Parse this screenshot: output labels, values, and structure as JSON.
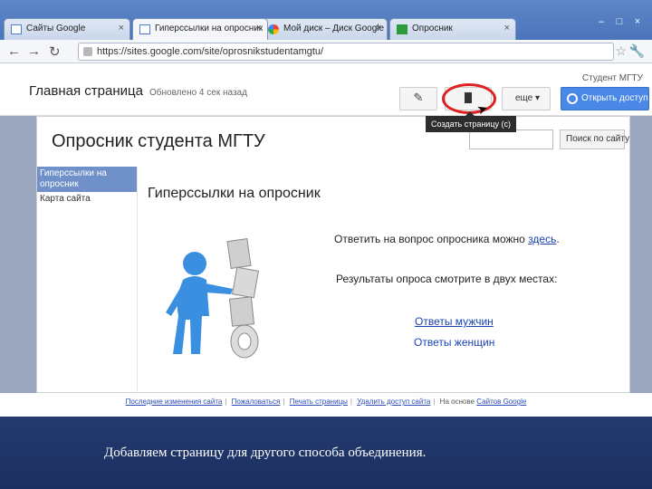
{
  "browser": {
    "tabs": [
      {
        "label": "Сайты Google",
        "icon": "sites-icon"
      },
      {
        "label": "Гиперссылки на опросник",
        "icon": "sites-icon"
      },
      {
        "label": "Мой диск – Диск Google",
        "icon": "drive-icon"
      },
      {
        "label": "Опросник",
        "icon": "forms-icon"
      }
    ],
    "close_glyph": "×",
    "url": "https://sites.google.com/site/oprosnikstudentamgtu/",
    "window_buttons": [
      "–",
      "□",
      "×"
    ]
  },
  "sites_header": {
    "user": "Студент МГТУ",
    "home_title": "Главная страница",
    "updated_text": "Обновлено 4 сек назад",
    "edit_icon": "✎",
    "more_label": "еще",
    "share_label": "Открыть доступ",
    "tooltip": "Создать страницу (с)"
  },
  "site": {
    "title": "Опросник студента МГТУ",
    "search_button": "Поиск по сайту",
    "sidebar": [
      {
        "label": "Гиперссылки на опросник",
        "active": true
      },
      {
        "label": "Карта сайта",
        "active": false
      }
    ],
    "page_title": "Гиперссылки на опросник",
    "answer_text": "Ответить на вопрос опросника можно",
    "answer_link": "здесь",
    "answer_period": ".",
    "results_text": "Результаты опроса смотрите в двух местах:",
    "men_link": "Ответы мужчин",
    "women_link": "Ответы женщин"
  },
  "footer": {
    "links": [
      "Последние изменения сайта",
      "Пожаловаться",
      "Печать страницы",
      "Удалить доступ сайта"
    ],
    "powered_prefix": "На основе",
    "powered_link": "Сайтов Google"
  },
  "caption": "Добавляем страницу для другого способа объединения.",
  "colors": {
    "accent": "#4a88e8",
    "highlight": "#e0201e",
    "link": "#1a43b0"
  }
}
